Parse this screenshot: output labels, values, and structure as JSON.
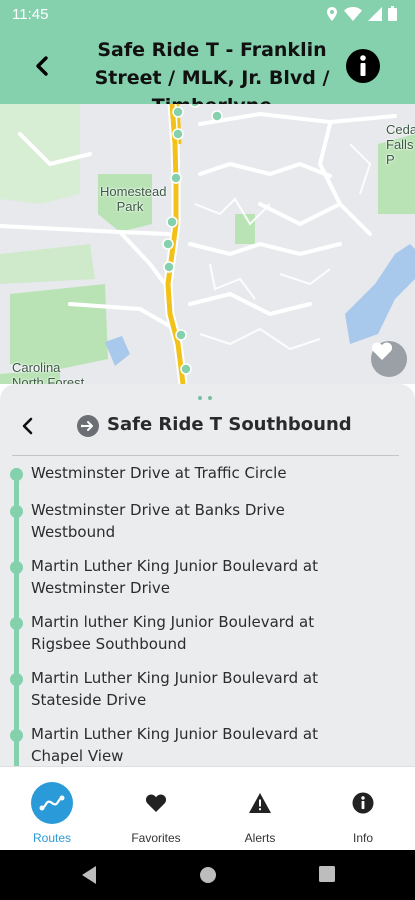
{
  "status_bar": {
    "time": "11:45",
    "icons": [
      "location-icon",
      "wifi-icon",
      "signal-icon",
      "battery-icon"
    ]
  },
  "header": {
    "title": "Safe Ride T - Franklin Street / MLK, Jr. Blvd / Timberlyne",
    "back_icon": "arrow-left-icon",
    "info_icon": "info-icon"
  },
  "map": {
    "labels": {
      "park": "Homestead\nPark",
      "forest": "Carolina\nNorth Forest",
      "falls": "Ceda\nFalls P"
    },
    "favorite_icon": "heart-icon",
    "colors": {
      "route": "#f2c21b",
      "stop": "#86d1ad",
      "park": "#b9e3b5",
      "water": "#a8c8ec"
    }
  },
  "sheet": {
    "title": "Safe Ride T Southbound",
    "direction_icon": "direction-arrow-icon",
    "back_icon": "chevron-left-icon",
    "stops": [
      "Westminster Drive at Traffic Circle",
      "Westminster Drive at Banks Drive Westbound",
      "Martin Luther King Junior Boulevard at Westminster Drive",
      "Martin luther King Junior Boulevard at Rigsbee Southbound",
      "Martin Luther King Junior Boulevard at Stateside Drive",
      "Martin Luther King Junior Boulevard at Chapel View"
    ]
  },
  "bottom_nav": {
    "items": [
      {
        "label": "Routes",
        "icon": "route-icon",
        "active": true
      },
      {
        "label": "Favorites",
        "icon": "heart-icon",
        "active": false
      },
      {
        "label": "Alerts",
        "icon": "warning-icon",
        "active": false
      },
      {
        "label": "Info",
        "icon": "info-icon",
        "active": false
      }
    ]
  },
  "colors": {
    "accent": "#86d1ad",
    "active_nav": "#2a9ad8"
  }
}
